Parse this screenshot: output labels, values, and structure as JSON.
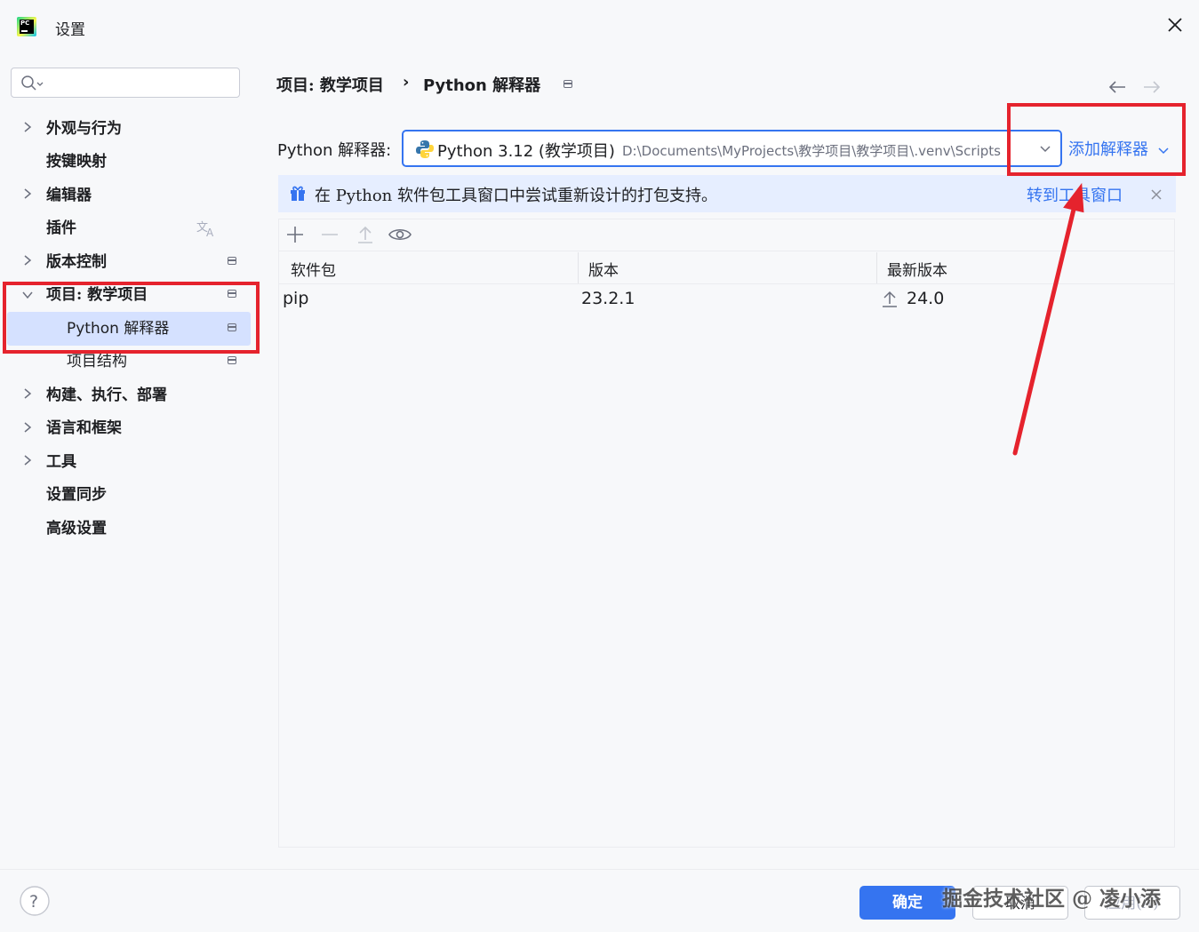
{
  "window": {
    "title": "设置"
  },
  "sidebar": {
    "search": {
      "placeholder": ""
    },
    "items": [
      {
        "label": "外观与行为"
      },
      {
        "label": "按键映射"
      },
      {
        "label": "编辑器"
      },
      {
        "label": "插件"
      },
      {
        "label": "版本控制"
      },
      {
        "label": "项目: 教学项目"
      },
      {
        "label": "Python 解释器"
      },
      {
        "label": "项目结构"
      },
      {
        "label": "构建、执行、部署"
      },
      {
        "label": "语言和框架"
      },
      {
        "label": "工具"
      },
      {
        "label": "设置同步"
      },
      {
        "label": "高级设置"
      }
    ]
  },
  "breadcrumb": {
    "parent": "项目: 教学项目",
    "separator": "›",
    "current": "Python 解释器"
  },
  "interpreter": {
    "label": "Python 解释器:",
    "name": "Python 3.12 (教学项目)",
    "path": "D:\\Documents\\MyProjects\\教学项目\\教学项目\\.venv\\Scripts",
    "add_label": "添加解释器"
  },
  "banner": {
    "text": "在 Python 软件包工具窗口中尝试重新设计的打包支持。",
    "link": "转到工具窗口"
  },
  "packages": {
    "columns": [
      "软件包",
      "版本",
      "最新版本"
    ],
    "rows": [
      {
        "name": "pip",
        "version": "23.2.1",
        "latest": "24.0"
      }
    ]
  },
  "footer": {
    "ok_label": "确定",
    "cancel_label": "取消",
    "apply_label": "应用(A)"
  },
  "watermark": "掘金技术社区 @ 凌小添",
  "colors": {
    "accent": "#3574f0",
    "selection": "#d5e1ff",
    "annotation": "#e5232d",
    "banner": "#e6eeff"
  },
  "icons": [
    "pycharm-logo-icon",
    "close-icon",
    "search-icon",
    "chevron-right-icon",
    "chevron-down-icon",
    "translate-icon",
    "pin-icon",
    "back-arrow-icon",
    "forward-arrow-icon",
    "python-icon",
    "gift-icon",
    "add-icon",
    "remove-icon",
    "upgrade-icon",
    "eye-icon",
    "help-icon"
  ]
}
